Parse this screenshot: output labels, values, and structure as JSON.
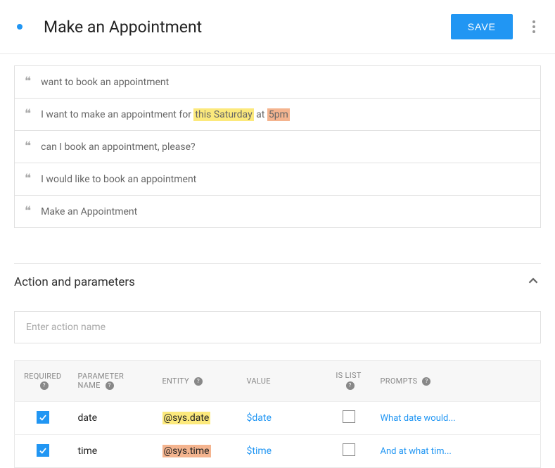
{
  "header": {
    "title": "Make an Appointment",
    "save_label": "SAVE"
  },
  "phrases": [
    {
      "prefix": "want to book an appointment",
      "highlights": []
    },
    {
      "prefix": "I want to make an appointment for ",
      "highlights": [
        {
          "text": "this Saturday",
          "class": "hl-yellow"
        },
        {
          "plain": " at "
        },
        {
          "text": "5pm",
          "class": "hl-orange"
        }
      ]
    },
    {
      "prefix": "can I book an appointment, please?",
      "highlights": []
    },
    {
      "prefix": "I would like to book an appointment",
      "highlights": []
    },
    {
      "prefix": "Make an Appointment",
      "highlights": []
    }
  ],
  "section": {
    "title": "Action and parameters",
    "action_placeholder": "Enter action name"
  },
  "table": {
    "headers": {
      "required": "REQUIRED",
      "param_name": "PARAMETER NAME",
      "entity": "ENTITY",
      "value": "VALUE",
      "is_list": "IS LIST",
      "prompts": "PROMPTS"
    },
    "rows": [
      {
        "required": true,
        "name": "date",
        "entity": "@sys.date",
        "entity_class": "entity-date",
        "value": "$date",
        "is_list": false,
        "prompt": "What date would..."
      },
      {
        "required": true,
        "name": "time",
        "entity": "@sys.time",
        "entity_class": "entity-time",
        "value": "$time",
        "is_list": false,
        "prompt": "And at what tim..."
      }
    ]
  }
}
